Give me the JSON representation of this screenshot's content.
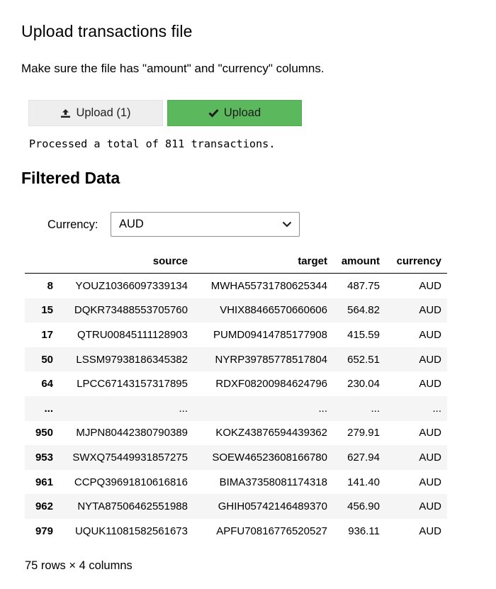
{
  "upload_section": {
    "title": "Upload transactions file",
    "instructions": "Make sure the file has \"amount\" and \"currency\" columns.",
    "file_button_label": "Upload (1)",
    "file_button_icon": "upload-icon",
    "upload_button_label": "Upload",
    "upload_button_icon": "check-icon",
    "upload_button_color": "#5cb85c",
    "output_text": "Processed a total of 811 transactions."
  },
  "filtered_section": {
    "title": "Filtered Data",
    "currency_label": "Currency:",
    "currency_selected": "AUD",
    "dropdown_icon": "chevron-down-icon"
  },
  "table": {
    "columns": [
      "",
      "source",
      "target",
      "amount",
      "currency"
    ],
    "rows": [
      [
        "8",
        "YOUZ10366097339134",
        "MWHA55731780625344",
        "487.75",
        "AUD"
      ],
      [
        "15",
        "DQKR73488553705760",
        "VHIX88466570660606",
        "564.82",
        "AUD"
      ],
      [
        "17",
        "QTRU00845111128903",
        "PUMD09414785177908",
        "415.59",
        "AUD"
      ],
      [
        "50",
        "LSSM97938186345382",
        "NYRP39785778517804",
        "652.51",
        "AUD"
      ],
      [
        "64",
        "LPCC67143157317895",
        "RDXF08200984624796",
        "230.04",
        "AUD"
      ],
      [
        "...",
        "...",
        "...",
        "...",
        "..."
      ],
      [
        "950",
        "MJPN80442380790389",
        "KOKZ43876594439362",
        "279.91",
        "AUD"
      ],
      [
        "953",
        "SWXQ75449931857275",
        "SOEW46523608166780",
        "627.94",
        "AUD"
      ],
      [
        "961",
        "CCPQ39691810616816",
        "BIMA37358081174318",
        "141.40",
        "AUD"
      ],
      [
        "962",
        "NYTA87506462551988",
        "GHIH05742146489370",
        "456.90",
        "AUD"
      ],
      [
        "979",
        "UQUK11081582561673",
        "APFU70816776520527",
        "936.11",
        "AUD"
      ]
    ],
    "summary": "75 rows × 4 columns"
  }
}
